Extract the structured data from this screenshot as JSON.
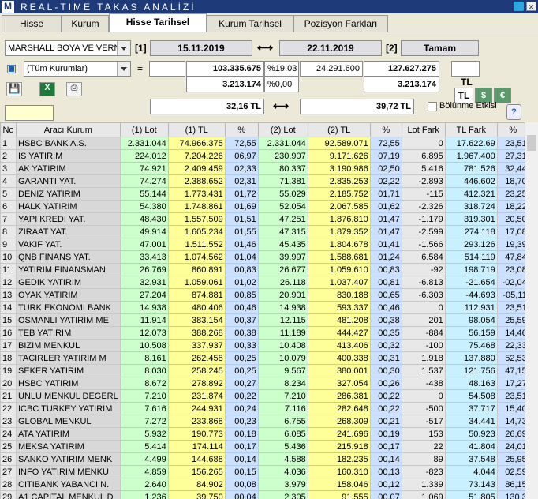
{
  "app": {
    "logo": "M",
    "title": "REAL-TIME TAKAS ANALİZİ"
  },
  "tabs": [
    "Hisse",
    "Kurum",
    "Hisse Tarihsel",
    "Kurum Tarihsel",
    "Pozisyon Farkları"
  ],
  "top": {
    "stock": "MARSHALL BOYA VE VERN",
    "d1_label": "[1]",
    "date1": "15.11.2019",
    "arrow": "⟷",
    "date2": "22.11.2019",
    "d2_label": "[2]",
    "ok": "Tamam",
    "institution": "(Tüm Kurumlar)",
    "eq": "=",
    "v1": "103.335.675",
    "p1": "%19,03",
    "v2": "24.291.600",
    "v3": "127.627.275",
    "v4": "3.213.174",
    "p2": "%0,00",
    "v5": "3.213.174",
    "curr": "TL",
    "c_tl": "TL",
    "c_usd": "$",
    "c_eur": "€",
    "price1": "32,16 TL",
    "price2": "39,72 TL",
    "split": "Bölünme Etkisi",
    "help": "?"
  },
  "columns": [
    "No",
    "Aracı Kurum",
    "(1) Lot",
    "(1) TL",
    "%",
    "(2) Lot",
    "(2) TL",
    "%",
    "Lot Fark",
    "TL Fark",
    "%"
  ],
  "rows": [
    [
      "1",
      "HSBC BANK A.S.",
      "2.331.044",
      "74.966.375",
      "72,55",
      "2.331.044",
      "92.589.071",
      "72,55",
      "0",
      "17.622.69",
      "23,51"
    ],
    [
      "2",
      "IS YATIRIM",
      "224.012",
      "7.204.226",
      "06,97",
      "230.907",
      "9.171.626",
      "07,19",
      "6.895",
      "1.967.400",
      "27,31"
    ],
    [
      "3",
      "AK YATIRIM",
      "74.921",
      "2.409.459",
      "02,33",
      "80.337",
      "3.190.986",
      "02,50",
      "5.416",
      "781.526",
      "32,44"
    ],
    [
      "4",
      "GARANTI YAT.",
      "74.274",
      "2.388.652",
      "02,31",
      "71.381",
      "2.835.253",
      "02,22",
      "-2.893",
      "446.602",
      "18,70"
    ],
    [
      "5",
      "DENIZ YATIRIM",
      "55.144",
      "1.773.431",
      "01,72",
      "55.029",
      "2.185.752",
      "01,71",
      "-115",
      "412.321",
      "23,25"
    ],
    [
      "6",
      "HALK YATIRIM",
      "54.380",
      "1.748.861",
      "01,69",
      "52.054",
      "2.067.585",
      "01,62",
      "-2.326",
      "318.724",
      "18,22"
    ],
    [
      "7",
      "YAPI KREDI YAT.",
      "48.430",
      "1.557.509",
      "01,51",
      "47.251",
      "1.876.810",
      "01,47",
      "-1.179",
      "319.301",
      "20,50"
    ],
    [
      "8",
      "ZIRAAT YAT.",
      "49.914",
      "1.605.234",
      "01,55",
      "47.315",
      "1.879.352",
      "01,47",
      "-2.599",
      "274.118",
      "17,08"
    ],
    [
      "9",
      "VAKIF YAT.",
      "47.001",
      "1.511.552",
      "01,46",
      "45.435",
      "1.804.678",
      "01,41",
      "-1.566",
      "293.126",
      "19,39"
    ],
    [
      "10",
      "QNB FINANS YAT.",
      "33.413",
      "1.074.562",
      "01,04",
      "39.997",
      "1.588.681",
      "01,24",
      "6.584",
      "514.119",
      "47,84"
    ],
    [
      "11",
      "YATIRIM FINANSMAN",
      "26.769",
      "860.891",
      "00,83",
      "26.677",
      "1.059.610",
      "00,83",
      "-92",
      "198.719",
      "23,08"
    ],
    [
      "12",
      "GEDIK YATIRIM",
      "32.931",
      "1.059.061",
      "01,02",
      "26.118",
      "1.037.407",
      "00,81",
      "-6.813",
      "-21.654",
      "-02,04"
    ],
    [
      "13",
      "OYAK YATIRIM",
      "27.204",
      "874.881",
      "00,85",
      "20.901",
      "830.188",
      "00,65",
      "-6.303",
      "-44.693",
      "-05,11"
    ],
    [
      "14",
      "TURK EKONOMI BANK",
      "14.938",
      "480.406",
      "00,46",
      "14.938",
      "593.337",
      "00,46",
      "0",
      "112.931",
      "23,51"
    ],
    [
      "15",
      "OSMANLI YATIRIM ME",
      "11.914",
      "383.154",
      "00,37",
      "12.115",
      "481.208",
      "00,38",
      "201",
      "98.054",
      "25,59"
    ],
    [
      "16",
      "TEB YATIRIM",
      "12.073",
      "388.268",
      "00,38",
      "11.189",
      "444.427",
      "00,35",
      "-884",
      "56.159",
      "14,46"
    ],
    [
      "17",
      "BIZIM MENKUL",
      "10.508",
      "337.937",
      "00,33",
      "10.408",
      "413.406",
      "00,32",
      "-100",
      "75.468",
      "22,33"
    ],
    [
      "18",
      "TACIRLER YATIRIM M",
      "8.161",
      "262.458",
      "00,25",
      "10.079",
      "400.338",
      "00,31",
      "1.918",
      "137.880",
      "52,53"
    ],
    [
      "19",
      "SEKER YATIRIM",
      "8.030",
      "258.245",
      "00,25",
      "9.567",
      "380.001",
      "00,30",
      "1.537",
      "121.756",
      "47,15"
    ],
    [
      "20",
      "HSBC YATIRIM",
      "8.672",
      "278.892",
      "00,27",
      "8.234",
      "327.054",
      "00,26",
      "-438",
      "48.163",
      "17,27"
    ],
    [
      "21",
      "UNLU MENKUL DEGERL",
      "7.210",
      "231.874",
      "00,22",
      "7.210",
      "286.381",
      "00,22",
      "0",
      "54.508",
      "23,51"
    ],
    [
      "22",
      "ICBC TURKEY YATIRIM",
      "7.616",
      "244.931",
      "00,24",
      "7.116",
      "282.648",
      "00,22",
      "-500",
      "37.717",
      "15,40"
    ],
    [
      "23",
      "GLOBAL MENKUL",
      "7.272",
      "233.868",
      "00,23",
      "6.755",
      "268.309",
      "00,21",
      "-517",
      "34.441",
      "14,73"
    ],
    [
      "24",
      "ATA YATIRIM",
      "5.932",
      "190.773",
      "00,18",
      "6.085",
      "241.696",
      "00,19",
      "153",
      "50.923",
      "26,69"
    ],
    [
      "25",
      "MEKSA YATIRIM",
      "5.414",
      "174.114",
      "00,17",
      "5.436",
      "215.918",
      "00,17",
      "22",
      "41.804",
      "24,01"
    ],
    [
      "26",
      "SANKO YATIRIM MENK",
      "4.499",
      "144.688",
      "00,14",
      "4.588",
      "182.235",
      "00,14",
      "89",
      "37.548",
      "25,95"
    ],
    [
      "27",
      "INFO YATIRIM MENKU",
      "4.859",
      "156.265",
      "00,15",
      "4.036",
      "160.310",
      "00,13",
      "-823",
      "4.044",
      "02,59"
    ],
    [
      "28",
      "CITIBANK YABANCI N.",
      "2.640",
      "84.902",
      "00,08",
      "3.979",
      "158.046",
      "00,12",
      "1.339",
      "73.143",
      "86,15"
    ],
    [
      "29",
      "A1 CAPITAL MENKUL D",
      "1.236",
      "39.750",
      "00,04",
      "2.305",
      "91.555",
      "00,07",
      "1.069",
      "51.805",
      "130,3"
    ]
  ]
}
